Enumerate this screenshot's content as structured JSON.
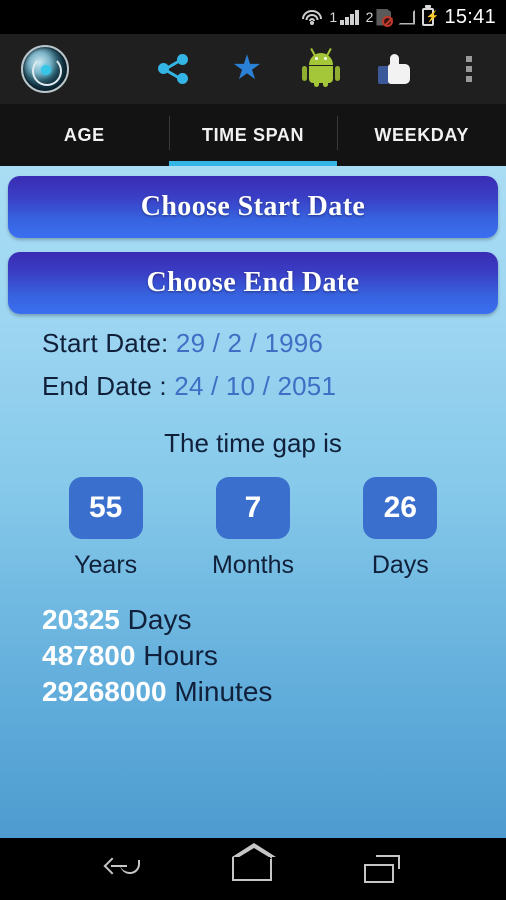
{
  "statusbar": {
    "sim1_label": "1",
    "sim2_label": "2",
    "clock": "15:41",
    "wifi_icon": "wifi-icon",
    "signal_icon": "signal-bars-icon",
    "sim_disabled_icon": "sim-disabled-icon",
    "no_signal_icon": "no-signal-icon",
    "battery_icon": "battery-charging-icon",
    "battery_glyph": "⚡"
  },
  "actionbar": {
    "logo_icon": "app-logo-icon",
    "share_icon": "share-icon",
    "star_icon": "star-icon",
    "star_glyph": "★",
    "android_icon": "android-robot-icon",
    "like_icon": "thumbs-up-icon",
    "overflow_icon": "overflow-menu-icon"
  },
  "tabs": [
    {
      "label": "AGE",
      "active": false
    },
    {
      "label": "TIME SPAN",
      "active": true
    },
    {
      "label": "WEEKDAY",
      "active": false
    }
  ],
  "main": {
    "choose_start_label": "Choose Start Date",
    "choose_end_label": "Choose End Date",
    "start_date_label": "Start Date:",
    "start_date_value": "29 / 2 / 1996",
    "end_date_label": "End Date  :",
    "end_date_value": "24 / 10 / 2051",
    "gap_title": "The time gap is",
    "gap_boxes": [
      {
        "value": "55",
        "label": "Years"
      },
      {
        "value": "7",
        "label": "Months"
      },
      {
        "value": "26",
        "label": "Days"
      }
    ],
    "totals": [
      {
        "number": "20325",
        "unit": "Days"
      },
      {
        "number": "487800",
        "unit": "Hours"
      },
      {
        "number": "29268000",
        "unit": "Minutes"
      }
    ]
  },
  "navbar": {
    "back_icon": "back-icon",
    "home_icon": "home-icon",
    "recents_icon": "recent-apps-icon"
  },
  "colors": {
    "accent": "#33b5e5",
    "button_gradient_top": "#3a2cb4",
    "button_gradient_bottom": "#3a6ff0",
    "box_blue": "#3a6fcd",
    "value_blue": "#3f6fc4",
    "text_navy": "#11203a"
  }
}
